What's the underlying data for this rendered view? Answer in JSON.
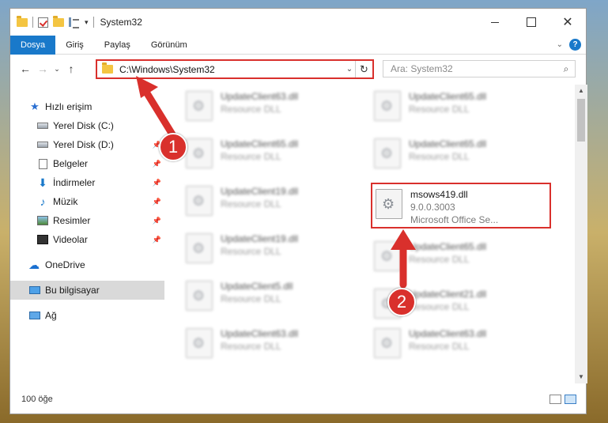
{
  "window": {
    "title": "System32"
  },
  "ribbon": {
    "tabs": [
      "Dosya",
      "Giriş",
      "Paylaş",
      "Görünüm"
    ],
    "help": "?"
  },
  "address": {
    "path": "C:\\Windows\\System32",
    "search_placeholder": "Ara: System32"
  },
  "nav": {
    "quick_access": "Hızlı erişim",
    "items": [
      {
        "label": "Yerel Disk (C:)",
        "icon": "drive-icon",
        "pinned": false
      },
      {
        "label": "Yerel Disk (D:)",
        "icon": "drive-icon",
        "pinned": true
      },
      {
        "label": "Belgeler",
        "icon": "documents-icon",
        "pinned": true
      },
      {
        "label": "İndirmeler",
        "icon": "downloads-icon",
        "pinned": true
      },
      {
        "label": "Müzik",
        "icon": "music-icon",
        "pinned": true
      },
      {
        "label": "Resimler",
        "icon": "pictures-icon",
        "pinned": true
      },
      {
        "label": "Videolar",
        "icon": "videos-icon",
        "pinned": true
      }
    ],
    "onedrive": "OneDrive",
    "this_pc": "Bu bilgisayar",
    "network": "Ağ"
  },
  "files": [
    {
      "name": "UpdateClient63.dll",
      "desc": "Resource DLL"
    },
    {
      "name": "UpdateClient65.dll",
      "desc": "Resource DLL"
    },
    {
      "name": "UpdateClient65.dll",
      "desc": "Resource DLL"
    },
    {
      "name": "UpdateClient65.dll",
      "desc": "Resource DLL"
    },
    {
      "name": "UpdateClient19.dll",
      "desc": "Resource DLL"
    },
    {
      "name": "UpdateClient19.dll",
      "desc": "Resource DLL"
    },
    {
      "name": "UpdateClient65.dll",
      "desc": "Resource DLL"
    },
    {
      "name": "UpdateClient5.dll",
      "desc": "Resource DLL"
    },
    {
      "name": "UpdateClient21.dll",
      "desc": "Resource DLL"
    },
    {
      "name": "UpdateClient63.dll",
      "desc": "Resource DLL"
    },
    {
      "name": "UpdateClient63.dll",
      "desc": "Resource DLL"
    }
  ],
  "highlighted_file": {
    "name": "msows419.dll",
    "version": "9.0.0.3003",
    "company": "Microsoft Office Se..."
  },
  "status": {
    "count": "100 öğe"
  },
  "annotations": {
    "step1": "1",
    "step2": "2",
    "color": "#d9302c"
  }
}
